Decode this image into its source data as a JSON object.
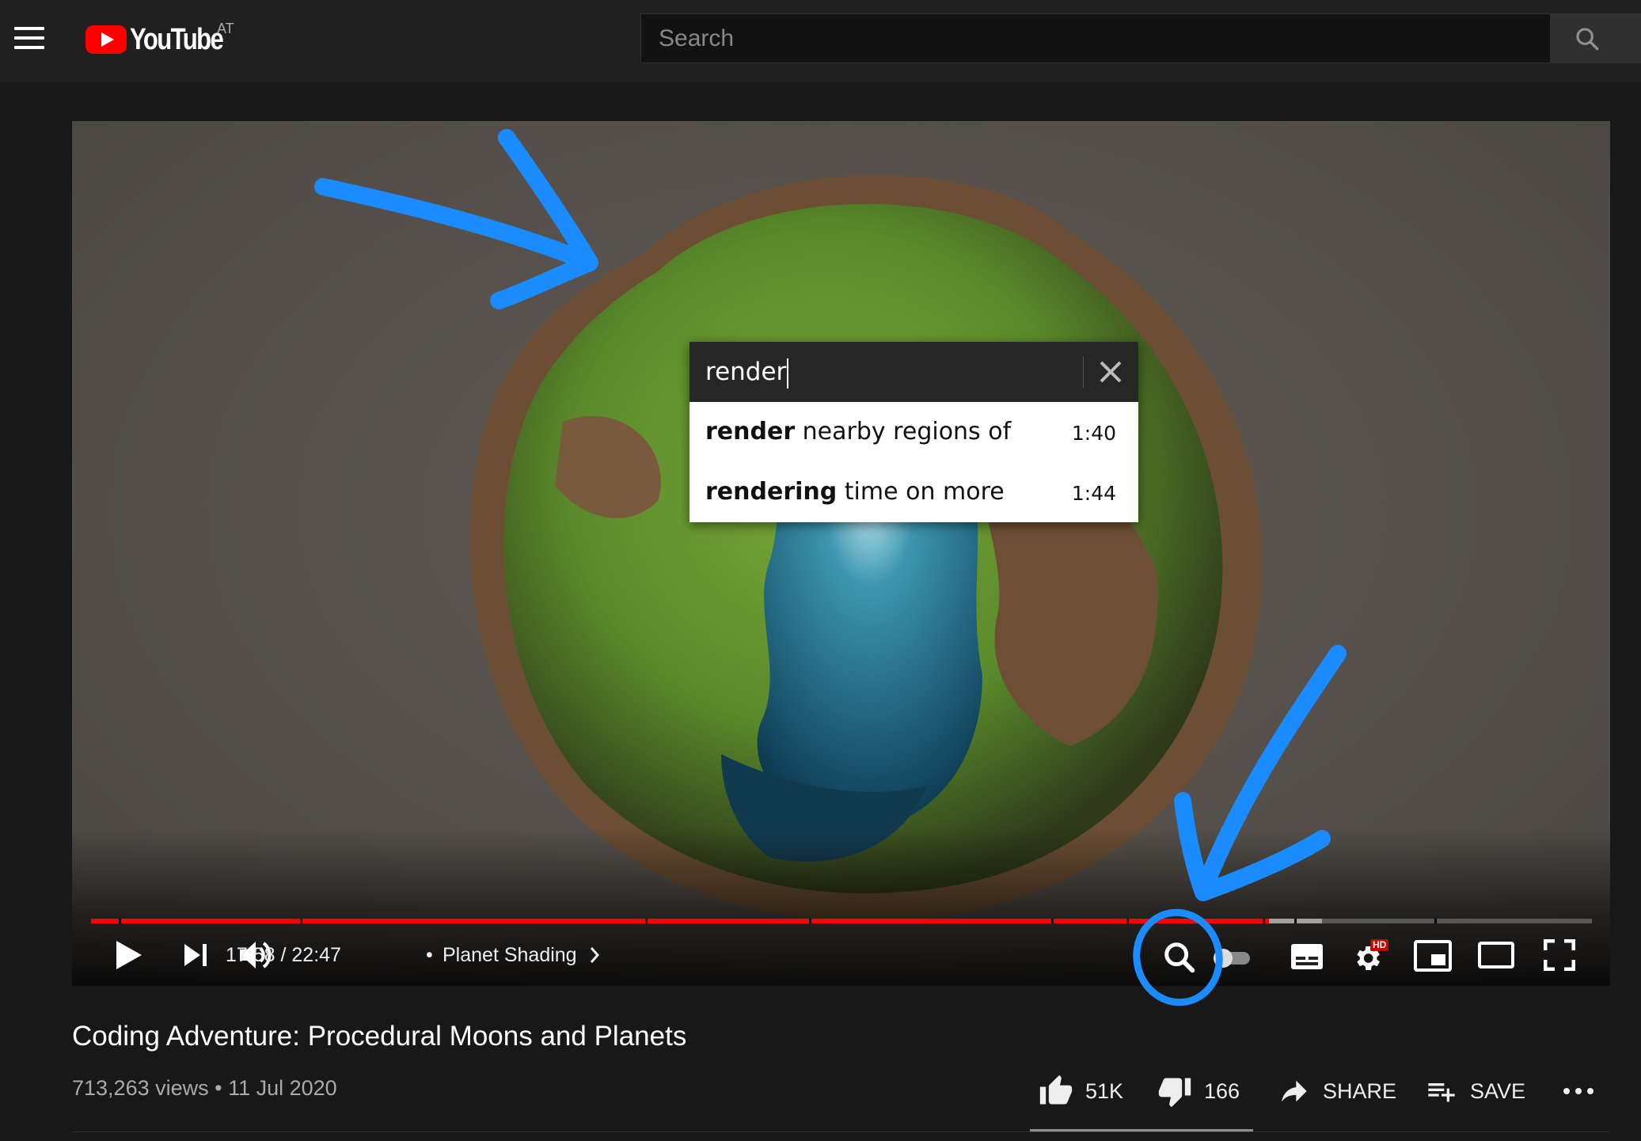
{
  "header": {
    "logo_text": "YouTube",
    "region": "AT",
    "search_placeholder": "Search"
  },
  "player": {
    "transcript_search": {
      "query": "render",
      "results": [
        {
          "match": "render",
          "rest": " nearby regions of",
          "time": "1:40"
        },
        {
          "match": "rendering",
          "rest": " time on more",
          "time": "1:44"
        }
      ]
    },
    "time_display": "17:58 / 22:47",
    "separator": "•",
    "chapter": "Planet Shading",
    "progress_played_fraction": 0.785,
    "progress_buffered_fraction": 0.82,
    "hd_badge": "HD"
  },
  "video": {
    "title": "Coding Adventure: Procedural Moons and Planets",
    "meta": "713,263 views • 11 Jul 2020"
  },
  "actions": {
    "likes": "51K",
    "dislikes": "166",
    "share": "SHARE",
    "save": "SAVE"
  },
  "colors": {
    "accent_red": "#ff0000",
    "annotation_blue": "#1a8cff",
    "background": "#181818"
  }
}
